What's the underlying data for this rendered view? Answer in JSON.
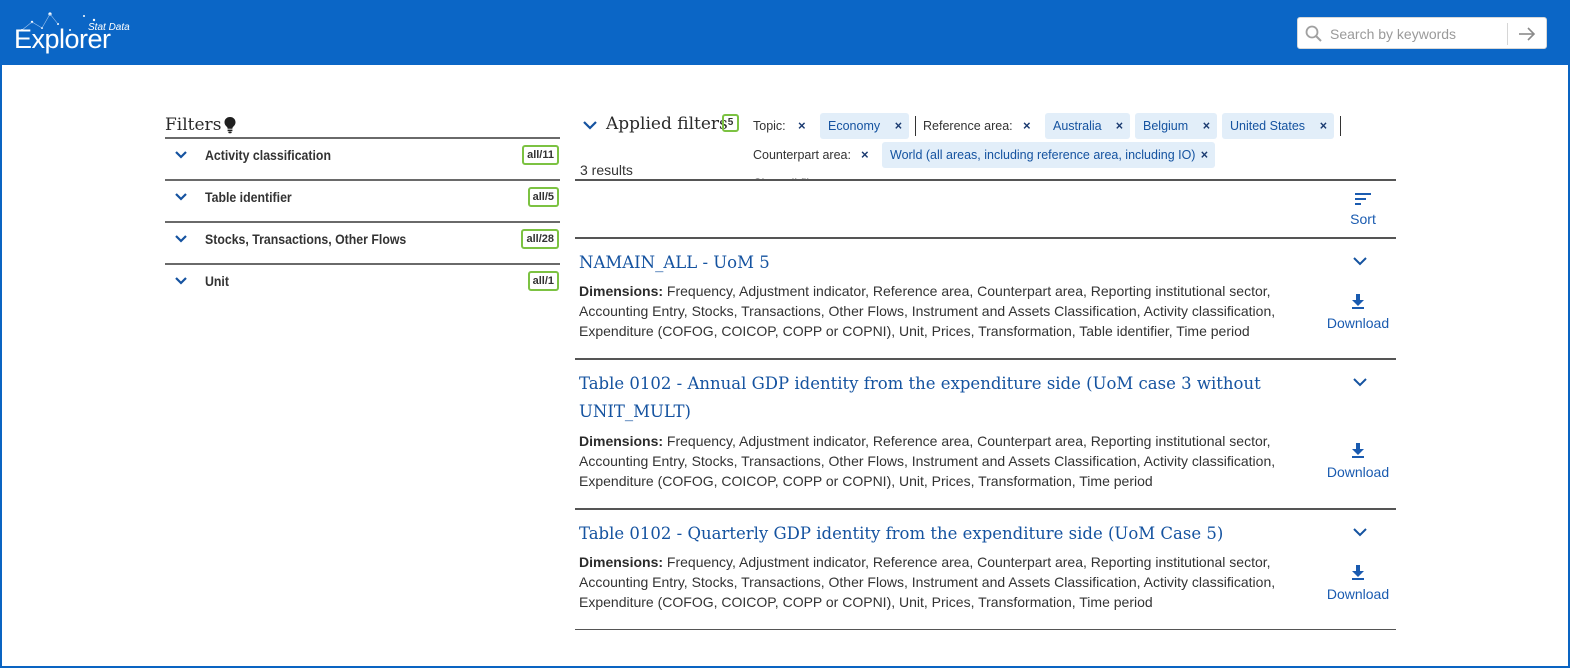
{
  "header": {
    "logo_text": "Explorer",
    "logo_subtext": "Stat Data",
    "search_placeholder": "Search by keywords"
  },
  "filters": {
    "title": "Filters",
    "items": [
      {
        "label": "Activity classification",
        "count": "all/11"
      },
      {
        "label": "Table identifier",
        "count": "all/5"
      },
      {
        "label": "Stocks, Transactions, Other Flows",
        "count": "all/28"
      },
      {
        "label": "Unit",
        "count": "all/1"
      }
    ]
  },
  "applied": {
    "title": "Applied filters",
    "count": "5",
    "topic_label": "Topic:",
    "topic_chip": "Economy",
    "ref_area_label": "Reference area:",
    "ref_chips": [
      "Australia",
      "Belgium",
      "United States"
    ],
    "counterpart_label": "Counterpart area:",
    "counterpart_chip": "World (all areas, including reference area, including IO)",
    "clear_all": "Clear all filters",
    "x": "×"
  },
  "results": {
    "count_text": "3 results",
    "sort_label": "Sort",
    "download_label": "Download",
    "dims_label": "Dimensions:",
    "items": [
      {
        "title": "NAMAIN_ALL - UoM 5",
        "dimensions": "Frequency, Adjustment indicator, Reference area, Counterpart area, Reporting institutional sector, Accounting Entry, Stocks, Transactions, Other Flows, Instrument and Assets Classification, Activity classification, Expenditure (COFOG, COICOP, COPP or COPNI), Unit, Prices, Transformation, Table identifier, Time period"
      },
      {
        "title": "Table 0102 - Annual GDP identity from the expenditure side (UoM case 3 without UNIT_MULT)",
        "dimensions": "Frequency, Adjustment indicator, Reference area, Counterpart area, Reporting institutional sector, Accounting Entry, Stocks, Transactions, Other Flows, Instrument and Assets Classification, Activity classification, Expenditure (COFOG, COICOP, COPP or COPNI), Unit, Prices, Transformation, Time period"
      },
      {
        "title": "Table 0102 - Quarterly GDP identity from the expenditure side (UoM Case 5)",
        "dimensions": "Frequency, Adjustment indicator, Reference area, Counterpart area, Reporting institutional sector, Accounting Entry, Stocks, Transactions, Other Flows, Instrument and Assets Classification, Activity classification, Expenditure (COFOG, COICOP, COPP or COPNI), Unit, Prices, Transformation, Time period"
      }
    ]
  },
  "colors": {
    "header_bg": "#0b66c6",
    "link_blue": "#1553a0",
    "badge_green": "#7cc242",
    "chip_bg": "#e2eef9"
  }
}
